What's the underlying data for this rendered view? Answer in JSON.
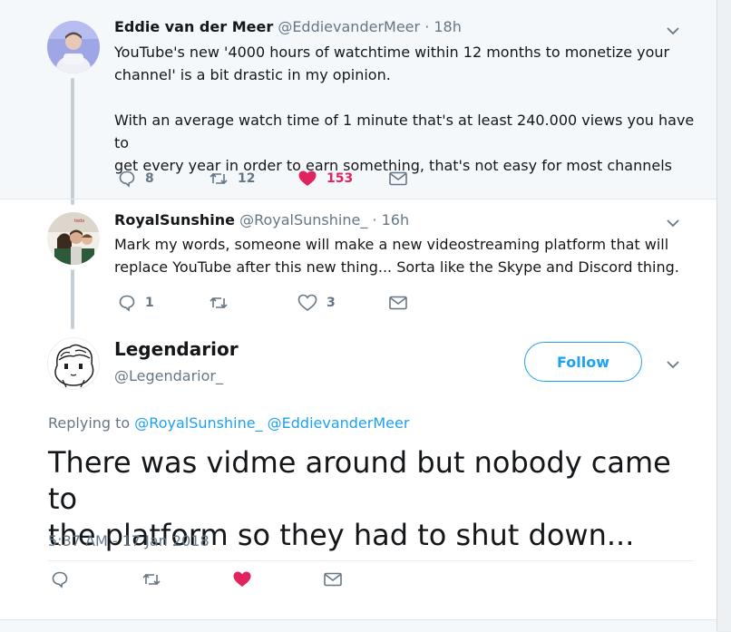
{
  "tweets": [
    {
      "name": "Eddie van der Meer",
      "handle": "@EddievanderMeer",
      "time": "· 18h",
      "text_lines": [
        "YouTube's new '4000 hours of watchtime within 12 months to monetize your",
        "channel' is a bit drastic in my opinion.",
        "",
        "With an average watch time of 1 minute that's at least 240.000 views you have to",
        "get every year in order to earn something, that's not easy for most channels"
      ],
      "replies": "8",
      "retweets": "12",
      "likes": "153",
      "liked": true
    },
    {
      "name": "RoyalSunshine",
      "handle": "@RoyalSunshine_",
      "time": "· 16h",
      "text_lines": [
        "Mark my words, someone will make a new videostreaming platform that will",
        "replace YouTube after this new thing... Sorta like the Skype and Discord thing."
      ],
      "replies": "1",
      "retweets": "",
      "likes": "3",
      "liked": false
    }
  ],
  "focused": {
    "name": "Legendarior",
    "handle": "@Legendarior_",
    "follow_label": "Follow",
    "replying_prefix": "Replying to",
    "replying_to": [
      "@RoyalSunshine_",
      "@EddievanderMeer"
    ],
    "text_lines": [
      "There was vidme around but nobody came to",
      "the platform so they had to shut down..."
    ],
    "timestamp": "5:37 AM - 17 Jan 2018"
  },
  "icons": {
    "reply": "reply-bubble-icon",
    "retweet": "retweet-icon",
    "like": "heart-icon",
    "message": "envelope-icon",
    "menu": "chevron-down-icon"
  },
  "colors": {
    "accent": "#1da1f2",
    "like": "#e0245e",
    "text": "#14171a",
    "muted": "#657786",
    "thread_line": "#c4cfd6"
  }
}
